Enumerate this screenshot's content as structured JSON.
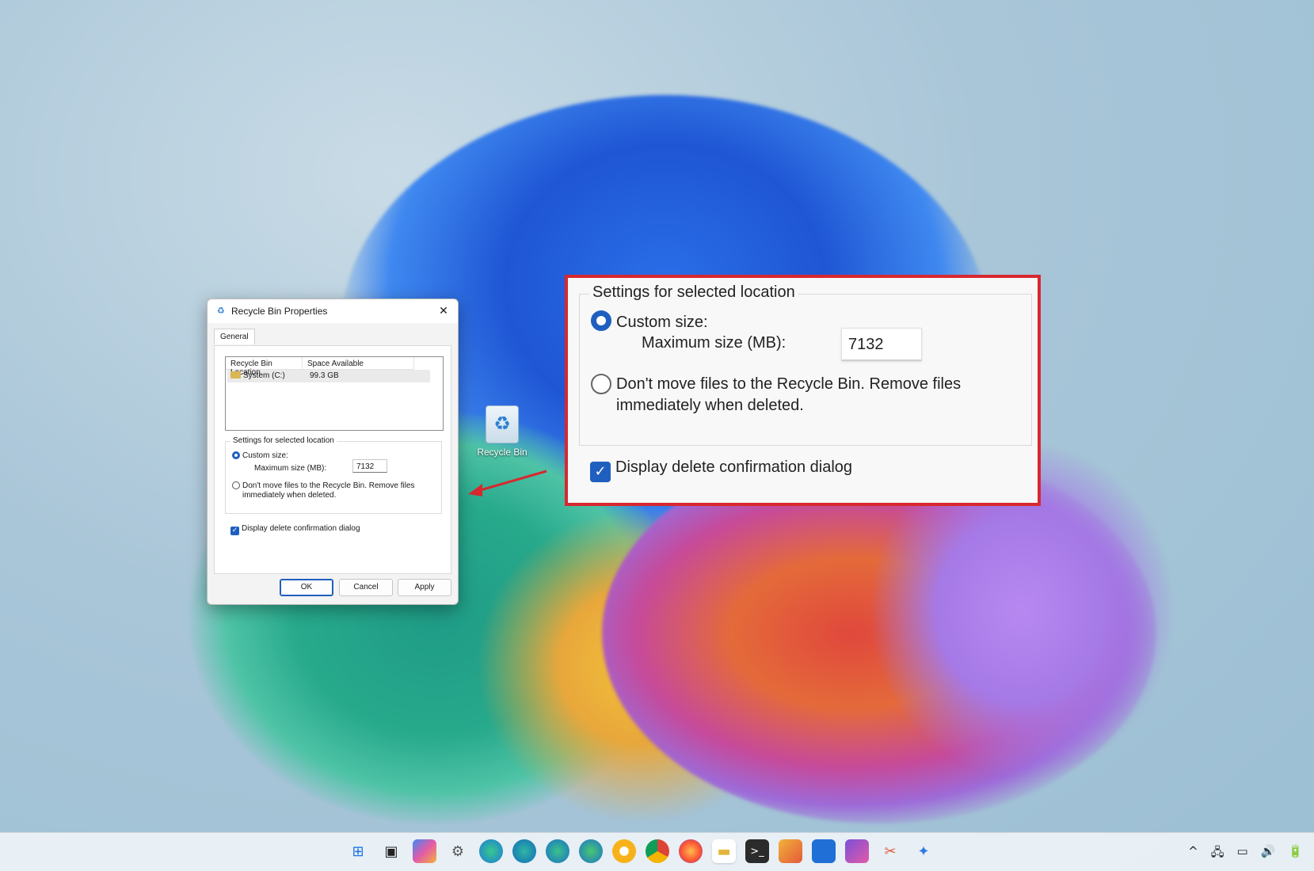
{
  "dialog": {
    "title": "Recycle Bin Properties",
    "close_glyph": "✕",
    "tab": "General",
    "list": {
      "columns": [
        "Recycle Bin Location",
        "Space Available"
      ],
      "rows": [
        {
          "location": "System (C:)",
          "space": "99.3 GB"
        }
      ]
    },
    "group_label": "Settings for selected location",
    "custom_size_label": "Custom size:",
    "max_size_label": "Maximum size (MB):",
    "max_size_value": "7132",
    "dont_move_label_line1": "Don't move files to the Recycle Bin. Remove files",
    "dont_move_label_line2": "immediately when deleted.",
    "confirm_label": "Display delete confirmation dialog",
    "ok": "OK",
    "cancel": "Cancel",
    "apply": "Apply"
  },
  "desktop": {
    "recycle_bin_label": "Recycle Bin"
  },
  "zoom": {
    "group_label": "Settings for selected location",
    "custom_size_label": "Custom size:",
    "max_size_label": "Maximum size (MB):",
    "max_size_value": "7132",
    "dont_move_label_line1": "Don't move files to the Recycle Bin. Remove files",
    "dont_move_label_line2": "immediately when deleted.",
    "confirm_label": "Display delete confirmation dialog"
  },
  "taskbar": {
    "icons": [
      "start-icon",
      "task-view-icon",
      "copilot-icon",
      "settings-icon",
      "edge-icon",
      "edge-canary-icon",
      "edge-beta-icon",
      "edge-dev-icon",
      "chrome-canary-icon",
      "chrome-icon",
      "firefox-icon",
      "file-explorer-icon",
      "terminal-icon",
      "paint-icon",
      "notepad-icon",
      "dev-home-icon",
      "snipping-tool-icon",
      "copilot-sparkle-icon"
    ],
    "tray": {
      "chevron": "^",
      "network": "🖧",
      "display": "▭",
      "volume": "🔊",
      "battery": "🔋"
    }
  },
  "colors": {
    "accent": "#1f5fbf",
    "callout_border": "#d7282f",
    "arrow": "#d7282f"
  }
}
